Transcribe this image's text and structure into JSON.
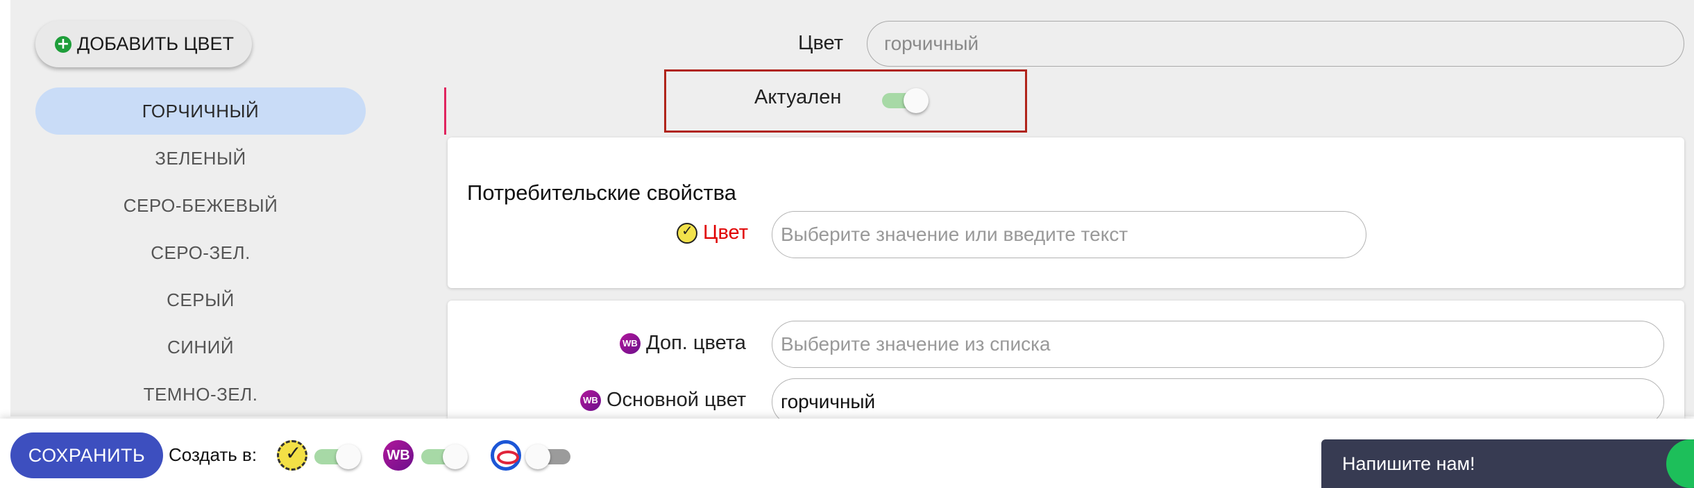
{
  "sidebar": {
    "add_button_label": "ДОБАВИТЬ ЦВЕТ",
    "items": [
      {
        "label": "ГОРЧИЧНЫЙ",
        "active": true
      },
      {
        "label": "ЗЕЛЕНЫЙ",
        "active": false
      },
      {
        "label": "СЕРО-БЕЖЕВЫЙ",
        "active": false
      },
      {
        "label": "СЕРО-ЗЕЛ.",
        "active": false
      },
      {
        "label": "СЕРЫЙ",
        "active": false
      },
      {
        "label": "СИНИЙ",
        "active": false
      },
      {
        "label": "ТЕМНО-ЗЕЛ.",
        "active": false
      }
    ]
  },
  "form": {
    "color_label": "Цвет",
    "color_value": "горчичный",
    "actual_label": "Актуален",
    "actual_on": true
  },
  "consumer": {
    "title": "Потребительские свойства",
    "color_label": "Цвет",
    "color_placeholder": "Выберите значение или введите текст"
  },
  "wb_props": {
    "extra_colors_label": "Доп. цвета",
    "extra_colors_placeholder": "Выберите значение из списка",
    "main_color_label": "Основной цвет",
    "main_color_value": "горчичный",
    "icon_text": "WB"
  },
  "bottom": {
    "save_label": "СОХРАНИТЬ",
    "create_in_label": "Создать в:",
    "marketplaces": [
      {
        "name": "yandex-market",
        "enabled": true
      },
      {
        "name": "wildberries",
        "enabled": true,
        "icon_text": "WB"
      },
      {
        "name": "ozon",
        "enabled": false
      }
    ]
  },
  "chat": {
    "label": "Напишите нам!"
  },
  "colors": {
    "accent": "#3d4fbf",
    "active_item": "#c9dcf7",
    "required": "#e00000",
    "highlight": "#b0241a",
    "toggle_on": "#a7d9a6",
    "chat_bg": "#373b52"
  }
}
